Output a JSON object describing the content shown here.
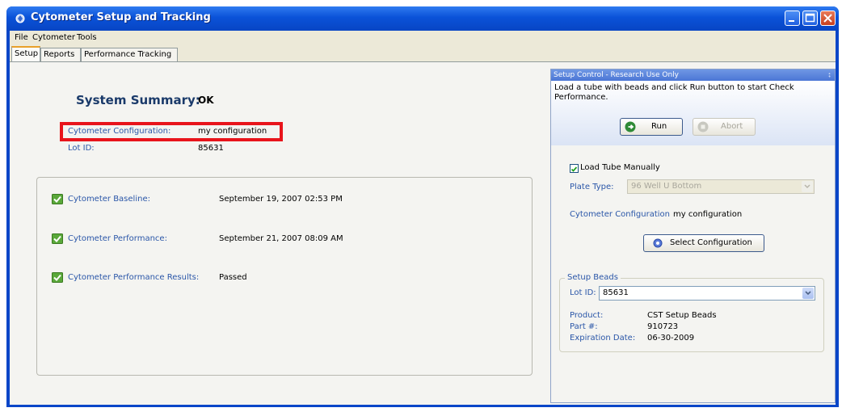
{
  "window": {
    "title": "Cytometer Setup and Tracking"
  },
  "menu": [
    "File",
    "Cytometer",
    "Tools"
  ],
  "tabs": [
    "Setup",
    "Reports",
    "Performance Tracking"
  ],
  "summary": {
    "title": "System Summary:",
    "status": "OK",
    "config_label": "Cytometer Configuration:",
    "config_value": "my configuration",
    "lot_label": "Lot ID:",
    "lot_value": "85631"
  },
  "results": [
    {
      "label": "Cytometer Baseline:",
      "value": "September 19, 2007 02:53 PM"
    },
    {
      "label": "Cytometer Performance:",
      "value": "September 21, 2007 08:09 AM"
    },
    {
      "label": "Cytometer Performance Results:",
      "value": "Passed"
    }
  ],
  "setup_control": {
    "header": "Setup Control - Research Use Only",
    "message": "Load a tube with beads and click Run button to start Check Performance.",
    "run_label": "Run",
    "abort_label": "Abort",
    "load_tube_label": "Load Tube Manually",
    "load_tube_checked": true,
    "plate_type_label": "Plate Type:",
    "plate_type_value": "96 Well U Bottom",
    "config_label": "Cytometer Configuration",
    "config_value": "my configuration",
    "select_config_label": "Select Configuration",
    "beads": {
      "legend": "Setup Beads",
      "lot_label": "Lot ID:",
      "lot_value": "85631",
      "product_label": "Product:",
      "product_value": "CST Setup Beads",
      "part_label": "Part #:",
      "part_value": "910723",
      "expiration_label": "Expiration Date:",
      "expiration_value": "06-30-2009"
    }
  },
  "colors": {
    "titlebar": "#0a52d8",
    "highlight_box": "#e8141b",
    "label_blue": "#2a56a8",
    "check_green": "#5aa83a"
  }
}
